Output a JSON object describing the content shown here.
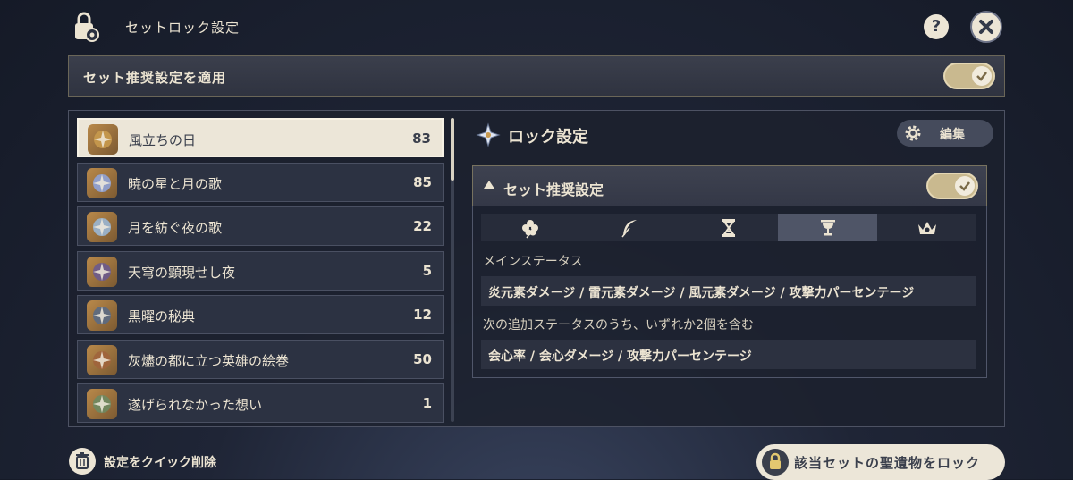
{
  "header": {
    "title": "セットロック設定",
    "help_symbol": "?",
    "lock_icon": "lock-gear-icon",
    "close_icon": "close-icon"
  },
  "banner": {
    "label": "セット推奨設定を適用",
    "toggle_on": true
  },
  "set_list": [
    {
      "name": "風立ちの日",
      "count": "83",
      "selected": true,
      "color": "#c89a4e"
    },
    {
      "name": "暁の星と月の歌",
      "count": "85",
      "selected": false,
      "color": "#8fa3d8"
    },
    {
      "name": "月を紡ぐ夜の歌",
      "count": "22",
      "selected": false,
      "color": "#9ab7d4"
    },
    {
      "name": "天穹の顕現せし夜",
      "count": "5",
      "selected": false,
      "color": "#6b5a8e"
    },
    {
      "name": "黒曜の秘典",
      "count": "12",
      "selected": false,
      "color": "#5a6a84"
    },
    {
      "name": "灰燼の都に立つ英雄の絵巻",
      "count": "50",
      "selected": false,
      "color": "#a0643c"
    },
    {
      "name": "遂げられなかった想い",
      "count": "1",
      "selected": false,
      "color": "#6e8a62"
    }
  ],
  "right_panel": {
    "title": "ロック設定",
    "edit_label": "編集",
    "recommend_label": "セット推奨設定",
    "recommend_toggle_on": true,
    "tabs": [
      "flower-icon",
      "feather-icon",
      "hourglass-icon",
      "goblet-icon",
      "circlet-icon"
    ],
    "active_tab": 3,
    "main_stat_label": "メインステータス",
    "main_stat_value": "炎元素ダメージ / 雷元素ダメージ / 風元素ダメージ / 攻撃力パーセンテージ",
    "sub_stat_label": "次の追加ステータスのうち、いずれか2個を含む",
    "sub_stat_value": "会心率 / 会心ダメージ / 攻撃力パーセンテージ"
  },
  "footer": {
    "quick_delete_label": "設定をクイック削除",
    "lock_set_label": "該当セットの聖遺物をロック"
  },
  "colors": {
    "accent_cream": "#ece6d8",
    "toggle_gold": "#c9b98f",
    "panel_bg": "#1c212e"
  }
}
